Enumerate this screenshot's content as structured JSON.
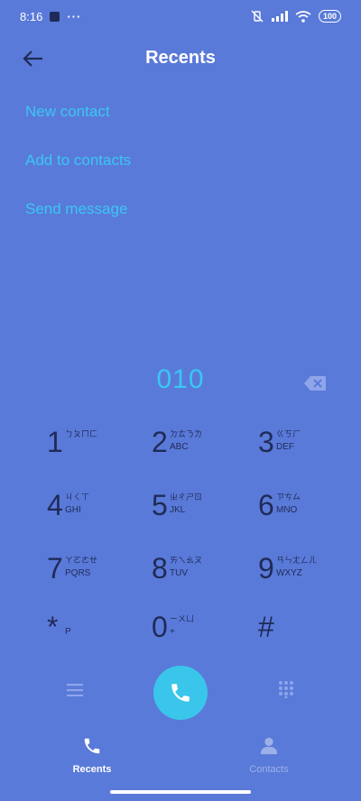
{
  "status_bar": {
    "time": "8:16",
    "notification_dots": "···",
    "battery": "100"
  },
  "header": {
    "title": "Recents"
  },
  "actions": [
    {
      "label": "New contact"
    },
    {
      "label": "Add to contacts"
    },
    {
      "label": "Send message"
    }
  ],
  "dialer": {
    "number": "010"
  },
  "keypad": [
    {
      "digit": "1",
      "zh": "ㄅㄆㄇㄈ",
      "letters": ""
    },
    {
      "digit": "2",
      "zh": "ㄉㄊㄋㄌ",
      "letters": "ABC"
    },
    {
      "digit": "3",
      "zh": "ㄍㄎㄏ",
      "letters": "DEF"
    },
    {
      "digit": "4",
      "zh": "ㄐㄑㄒ",
      "letters": "GHI"
    },
    {
      "digit": "5",
      "zh": "ㄓㄔㄕㄖ",
      "letters": "JKL"
    },
    {
      "digit": "6",
      "zh": "ㄗㄘㄙ",
      "letters": "MNO"
    },
    {
      "digit": "7",
      "zh": "ㄚㄛㄜㄝ",
      "letters": "PQRS"
    },
    {
      "digit": "8",
      "zh": "ㄞㄟㄠㄡ",
      "letters": "TUV"
    },
    {
      "digit": "9",
      "zh": "ㄢㄣㄤㄥㄦ",
      "letters": "WXYZ"
    },
    {
      "digit": "*",
      "zh": "",
      "letters": "P"
    },
    {
      "digit": "0",
      "zh": "ㄧㄨㄩ",
      "letters": "+"
    },
    {
      "digit": "#",
      "zh": "",
      "letters": ""
    }
  ],
  "tabs": [
    {
      "label": "Recents",
      "icon": "phone-icon",
      "active": true
    },
    {
      "label": "Contacts",
      "icon": "person-icon",
      "active": false
    }
  ],
  "colors": {
    "background": "#5a7ad9",
    "accent": "#39c7f3",
    "call_button": "#3ac6ea",
    "dark": "#1f2b57"
  }
}
